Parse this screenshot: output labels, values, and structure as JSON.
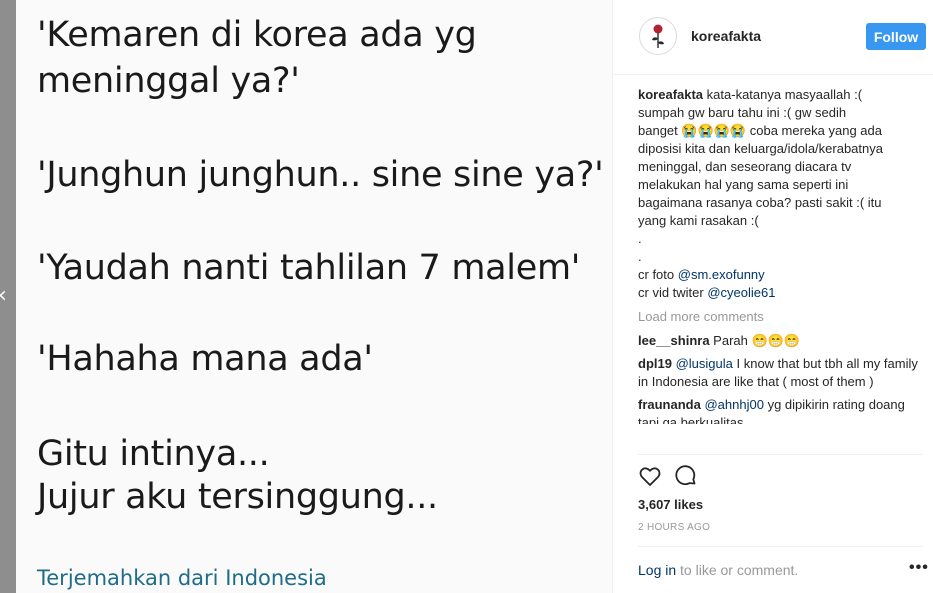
{
  "post": {
    "username": "koreafakta",
    "follow_label": "Follow",
    "meme_lines": [
      "'Kemaren di korea ada yg",
      "meninggal ya?'",
      "'Junghun junghun.. sine sine ya?'",
      "'Yaudah nanti tahlilan 7 malem'",
      "'Hahaha mana ada'",
      "Gitu intinya...",
      "Jujur aku tersinggung..."
    ],
    "translate_label": "Terjemahkan dari Indonesia"
  },
  "caption": {
    "username": "koreafakta",
    "lines": [
      "kata-katanya masyaallah :(",
      "sumpah gw baru tahu ini :( gw sedih",
      "banget 😭😭😭😭 coba mereka yang ada",
      "diposisi kita dan keluarga/idola/kerabatnya",
      "meninggal, dan seseorang diacara tv",
      "melakukan hal yang sama seperti ini",
      "bagaimana rasanya coba? pasti sakit :( itu",
      "yang kami rasakan :(",
      ".",
      "."
    ],
    "credit_photo_prefix": "cr foto",
    "credit_photo_handle": "@sm.exofunny",
    "credit_vid_prefix": "cr vid twiter",
    "credit_vid_handle": "@cyeolie61"
  },
  "load_more_label": "Load more comments",
  "comments": [
    {
      "user": "lee__shinra",
      "text": "Parah 😁😁😁"
    },
    {
      "user": "dpl19",
      "mention": "@lusigula",
      "text": "I know that but tbh all my family in Indonesia are like that ( most of them )"
    },
    {
      "user": "fraunanda",
      "mention": "@ahnhj00",
      "text": "yg dipikirin rating doang tapi ga berkualitas"
    }
  ],
  "likes_label": "3,607 likes",
  "timestamp": "2 HOURS AGO",
  "login": {
    "link": "Log in",
    "rest": "to like or comment."
  },
  "more_label": "•••",
  "icons": {
    "like": "heart-icon",
    "comment": "comment-icon",
    "prev": "chevron-left-icon",
    "avatar": "rose-avatar"
  },
  "colors": {
    "follow": "#3897f0",
    "link": "#003569",
    "muted": "#999999"
  }
}
